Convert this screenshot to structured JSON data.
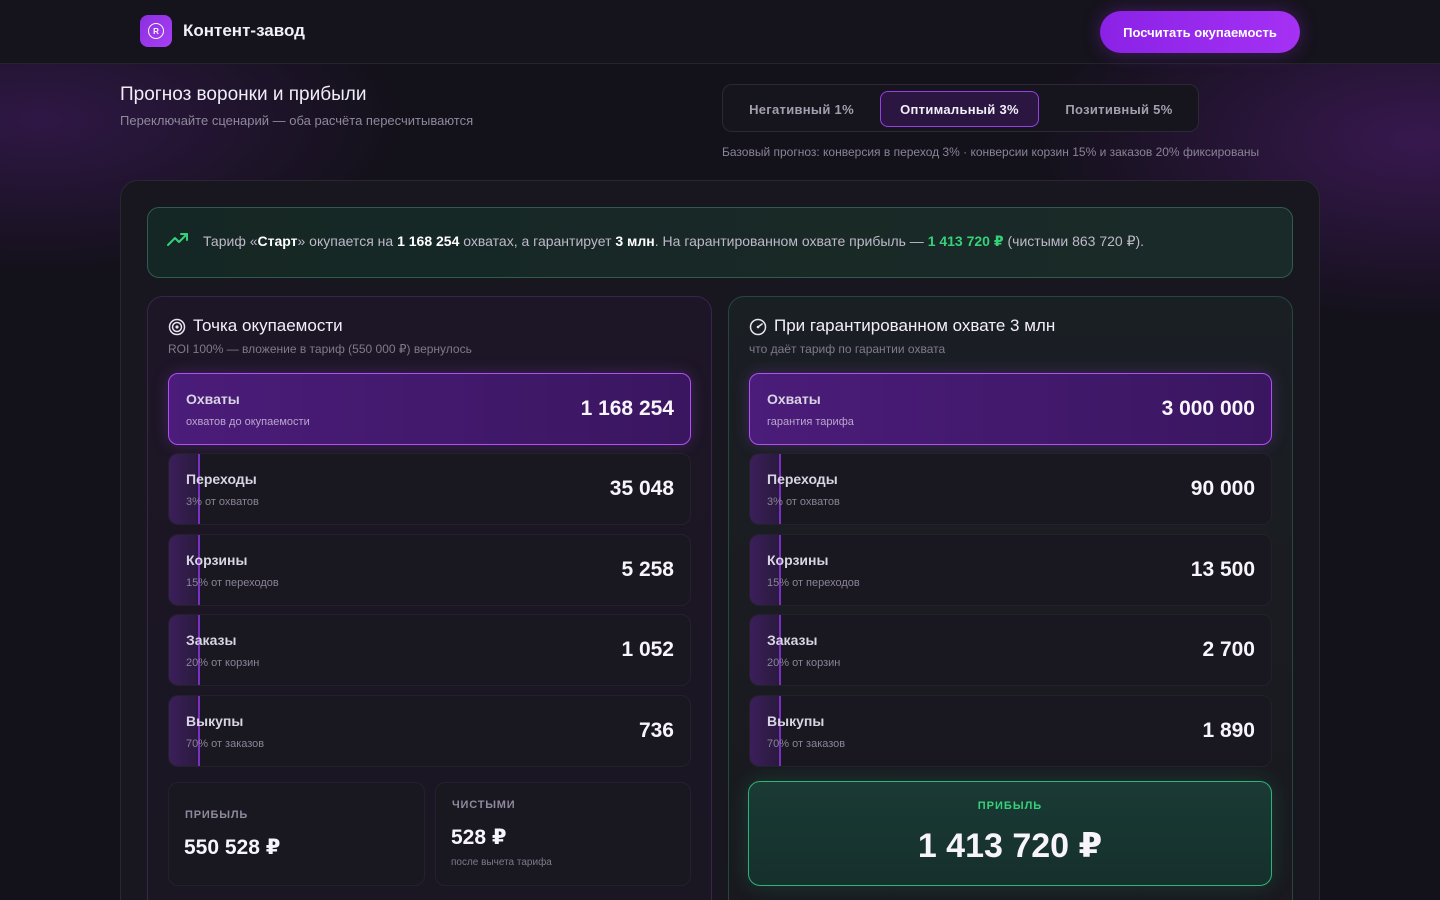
{
  "header": {
    "brand": "Контент-завод",
    "logo_letter": "R",
    "cta_label": "Посчитать окупаемость"
  },
  "page": {
    "title": "Прогноз воронки и прибыли",
    "subtitle": "Переключайте сценарий — оба расчёта пересчитываются"
  },
  "scenarios": {
    "items": [
      {
        "label": "Негативный 1%",
        "active": false
      },
      {
        "label": "Оптимальный 3%",
        "active": true
      },
      {
        "label": "Позитивный 5%",
        "active": false
      }
    ],
    "note": "Базовый прогноз: конверсия в переход 3% · конверсии корзин 15% и заказов 20% фиксированы"
  },
  "banner": {
    "p1": "Тариф «",
    "tariff": "Старт",
    "p2": "» окупается на ",
    "reach": "1 168 254",
    "p3": " охватах, а гарантирует ",
    "guarantee": "3 млн",
    "p4": ". На гарантированном охвате прибыль — ",
    "profit": "1 413 720 ₽",
    "p5": " (чистыми 863 720 ₽)."
  },
  "left": {
    "title": "Точка окупаемости",
    "subtitle": "ROI 100% — вложение в тариф (550 000 ₽) вернулось",
    "rows": [
      {
        "label": "Охваты",
        "hint": "охватов до окупаемости",
        "value": "1 168 254",
        "fill": 1.0
      },
      {
        "label": "Переходы",
        "hint": "3% от охватов",
        "value": "35 048",
        "fill": 0.06
      },
      {
        "label": "Корзины",
        "hint": "15% от переходов",
        "value": "5 258",
        "fill": 0.06
      },
      {
        "label": "Заказы",
        "hint": "20% от корзин",
        "value": "1 052",
        "fill": 0.06
      },
      {
        "label": "Выкупы",
        "hint": "70% от заказов",
        "value": "736",
        "fill": 0.06
      }
    ],
    "profit": {
      "caption": "ПРИБЫЛЬ",
      "value": "550 528 ₽"
    },
    "net": {
      "caption": "ЧИСТЫМИ",
      "value": "528 ₽",
      "hint": "после вычета тарифа"
    }
  },
  "right": {
    "title": "При гарантированном охвате 3 млн",
    "subtitle": "что даёт тариф по гарантии охвата",
    "rows": [
      {
        "label": "Охваты",
        "hint": "гарантия тарифа",
        "value": "3 000 000",
        "fill": 1.0
      },
      {
        "label": "Переходы",
        "hint": "3% от охватов",
        "value": "90 000",
        "fill": 0.06
      },
      {
        "label": "Корзины",
        "hint": "15% от переходов",
        "value": "13 500",
        "fill": 0.06
      },
      {
        "label": "Заказы",
        "hint": "20% от корзин",
        "value": "2 700",
        "fill": 0.06
      },
      {
        "label": "Выкупы",
        "hint": "70% от заказов",
        "value": "1 890",
        "fill": 0.06
      }
    ],
    "profit": {
      "caption": "ПРИБЫЛЬ",
      "value": "1 413 720 ₽"
    }
  },
  "colors": {
    "accent": "#a531f4",
    "success": "#36d07a",
    "background": "#13111a"
  },
  "icons": [
    "trend-up-icon",
    "target-icon",
    "gauge-icon"
  ]
}
